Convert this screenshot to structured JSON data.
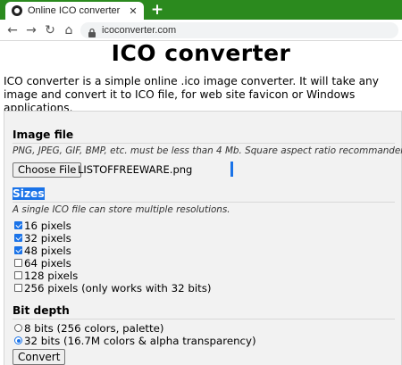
{
  "browser": {
    "tab_title": "Online ICO converter",
    "tab_close": "✕",
    "new_tab": "+",
    "back": "←",
    "forward": "→",
    "reload": "↻",
    "home": "⌂",
    "url": "icoconverter.com",
    "tab_color": "#2b8a1e"
  },
  "page": {
    "title": "ICO converter",
    "intro": "ICO converter is a simple online .ico image converter. It will take any image and convert it to ICO file, for web site favicon or Windows applications.",
    "image_file": {
      "heading": "Image file",
      "note": "PNG, JPEG, GIF, BMP, etc. must be less than 4 Mb. Square aspect ratio recommandend.",
      "choose_button": "Choose File",
      "filename": "LISTOFFREEWARE.png"
    },
    "sizes": {
      "heading": "Sizes",
      "note": "A single ICO file can store multiple resolutions.",
      "options": [
        {
          "label": "16 pixels",
          "checked": true
        },
        {
          "label": "32 pixels",
          "checked": true
        },
        {
          "label": "48 pixels",
          "checked": true
        },
        {
          "label": "64 pixels",
          "checked": false
        },
        {
          "label": "128 pixels",
          "checked": false
        },
        {
          "label": "256 pixels (only works with 32 bits)",
          "checked": false
        }
      ]
    },
    "bit_depth": {
      "heading": "Bit depth",
      "options": [
        {
          "label": "8 bits (256 colors, palette)",
          "checked": false
        },
        {
          "label": "32 bits (16.7M colors & alpha transparency)",
          "checked": true
        }
      ]
    },
    "convert_button": "Convert",
    "accent_color": "#1a73e8"
  }
}
